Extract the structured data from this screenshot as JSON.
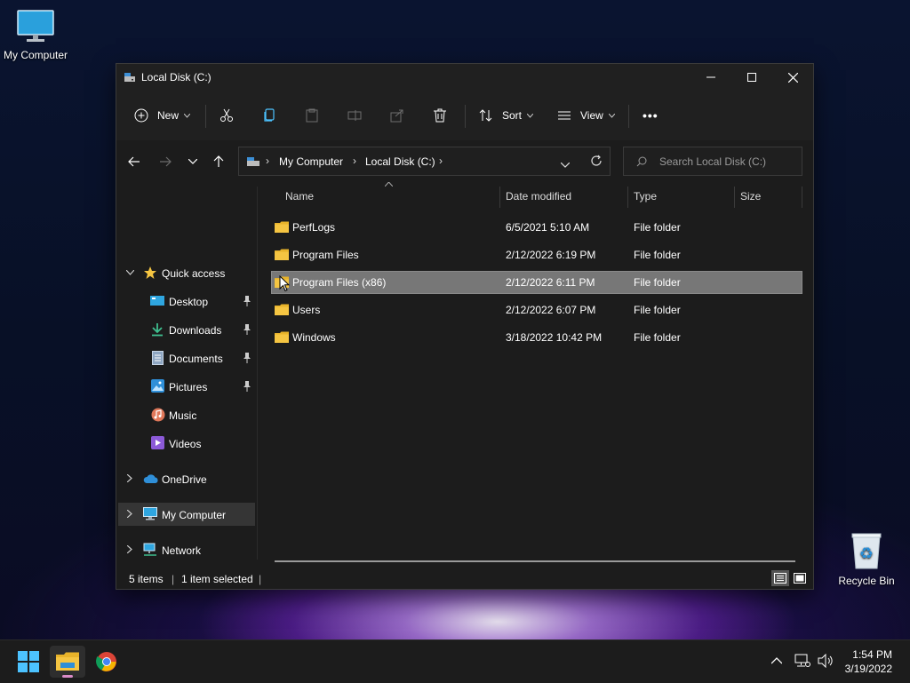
{
  "desktop": {
    "my_computer_label": "My Computer",
    "recycle_bin_label": "Recycle Bin"
  },
  "window": {
    "title": "Local Disk (C:)",
    "toolbar": {
      "new_label": "New",
      "sort_label": "Sort",
      "view_label": "View",
      "more_label": "•••"
    },
    "address": {
      "segments": [
        "My Computer",
        "Local Disk (C:)"
      ],
      "search_placeholder": "Search Local Disk (C:)"
    },
    "nav": {
      "quick_access": "Quick access",
      "items": [
        {
          "label": "Desktop",
          "icon": "desktop-folder-icon",
          "pinned": true
        },
        {
          "label": "Downloads",
          "icon": "downloads-icon",
          "pinned": true
        },
        {
          "label": "Documents",
          "icon": "documents-icon",
          "pinned": true
        },
        {
          "label": "Pictures",
          "icon": "pictures-icon",
          "pinned": true
        },
        {
          "label": "Music",
          "icon": "music-icon",
          "pinned": false
        },
        {
          "label": "Videos",
          "icon": "videos-icon",
          "pinned": false
        }
      ],
      "onedrive": "OneDrive",
      "my_computer": "My Computer",
      "network": "Network"
    },
    "columns": {
      "name": "Name",
      "date_modified": "Date modified",
      "type": "Type",
      "size": "Size"
    },
    "files": [
      {
        "name": "PerfLogs",
        "date": "6/5/2021 5:10 AM",
        "type": "File folder",
        "selected": false
      },
      {
        "name": "Program Files",
        "date": "2/12/2022 6:19 PM",
        "type": "File folder",
        "selected": false
      },
      {
        "name": "Program Files (x86)",
        "date": "2/12/2022 6:11 PM",
        "type": "File folder",
        "selected": true
      },
      {
        "name": "Users",
        "date": "2/12/2022 6:07 PM",
        "type": "File folder",
        "selected": false
      },
      {
        "name": "Windows",
        "date": "3/18/2022 10:42 PM",
        "type": "File folder",
        "selected": false
      }
    ],
    "status": {
      "item_count": "5 items",
      "selection": "1 item selected"
    }
  },
  "taskbar": {
    "time": "1:54 PM",
    "date": "3/19/2022"
  },
  "colors": {
    "folder": "#f5c542",
    "selection": "#777777",
    "window_bg": "#1c1c1c",
    "accent": "#4cc2ff"
  }
}
